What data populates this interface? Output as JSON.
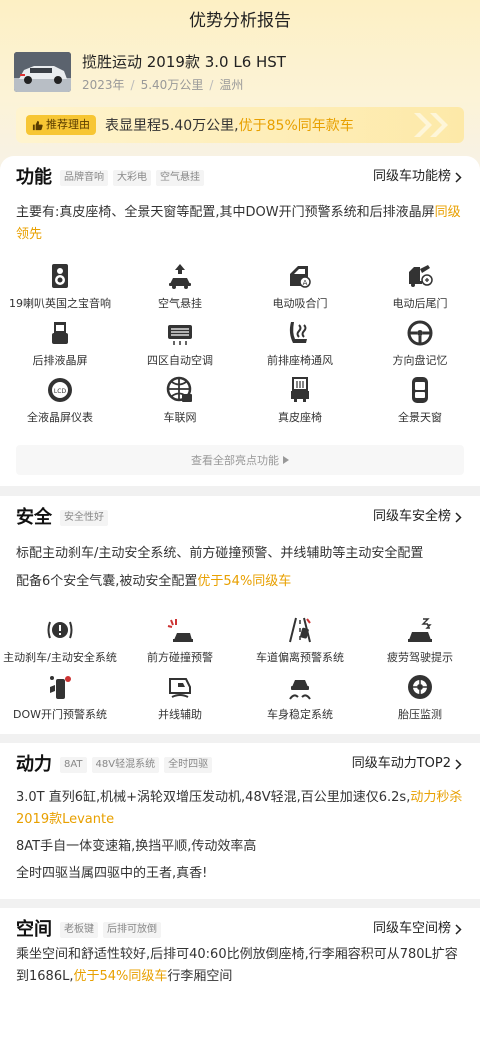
{
  "page_title": "优势分析报告",
  "car": {
    "title": "揽胜运动 2019款 3.0 L6 HST",
    "year": "2023年",
    "mileage": "5.40万公里",
    "city": "温州",
    "sep": "/"
  },
  "reason": {
    "badge": "推荐理由",
    "text_plain": "表显里程5.40万公里,",
    "text_highlight": "优于85%同年款车"
  },
  "function": {
    "title": "功能",
    "tags": [
      "品牌音响",
      "大彩电",
      "空气悬挂"
    ],
    "rank": "同级车功能榜",
    "desc_plain": "主要有:真皮座椅、全景天窗等配置,其中DOW开门预警系统和后排液晶屏",
    "desc_highlight": "同级领先",
    "features": [
      {
        "label": "19喇叭英国之宝音响",
        "icon": "speaker-icon"
      },
      {
        "label": "空气悬挂",
        "icon": "air-suspension-icon"
      },
      {
        "label": "电动吸合门",
        "icon": "soft-close-door-icon"
      },
      {
        "label": "电动后尾门",
        "icon": "power-tailgate-icon"
      },
      {
        "label": "后排液晶屏",
        "icon": "rear-screen-icon"
      },
      {
        "label": "四区自动空调",
        "icon": "climate-control-icon"
      },
      {
        "label": "前排座椅通风",
        "icon": "seat-ventilation-icon"
      },
      {
        "label": "方向盘记忆",
        "icon": "steering-memory-icon"
      },
      {
        "label": "全液晶屏仪表",
        "icon": "lcd-dashboard-icon"
      },
      {
        "label": "车联网",
        "icon": "connected-car-icon"
      },
      {
        "label": "真皮座椅",
        "icon": "leather-seat-icon"
      },
      {
        "label": "全景天窗",
        "icon": "panoramic-sunroof-icon"
      }
    ],
    "more": "查看全部亮点功能"
  },
  "safety": {
    "title": "安全",
    "tags": [
      "安全性好"
    ],
    "rank": "同级车安全榜",
    "desc_line1": "标配主动刹车/主动安全系统、前方碰撞预警、并线辅助等主动安全配置",
    "desc_line2_plain": "配备6个安全气囊,被动安全配置",
    "desc_line2_highlight": "优于54%同级车",
    "features": [
      {
        "label": "主动刹车/主动安全系统",
        "icon": "auto-brake-icon"
      },
      {
        "label": "前方碰撞预警",
        "icon": "collision-warning-icon"
      },
      {
        "label": "车道偏离预警系统",
        "icon": "lane-departure-icon"
      },
      {
        "label": "疲劳驾驶提示",
        "icon": "fatigue-alert-icon"
      },
      {
        "label": "DOW开门预警系统",
        "icon": "door-open-warning-icon"
      },
      {
        "label": "并线辅助",
        "icon": "blind-spot-icon"
      },
      {
        "label": "车身稳定系统",
        "icon": "stability-control-icon"
      },
      {
        "label": "胎压监测",
        "icon": "tire-pressure-icon"
      }
    ]
  },
  "power": {
    "title": "动力",
    "tags": [
      "8AT",
      "48V轻混系统",
      "全时四驱"
    ],
    "rank": "同级车动力TOP2",
    "desc1_plain": "3.0T 直列6缸,机械+涡轮双增压发动机,48V轻混,百公里加速仅6.2s,",
    "desc1_highlight": "动力秒杀 2019款Levante",
    "desc2": "8AT手自一体变速箱,换挡平顺,传动效率高",
    "desc3": "全时四驱当属四驱中的王者,真香!"
  },
  "space": {
    "title": "空间",
    "tags": [
      "老板键",
      "后排可放倒"
    ],
    "rank": "同级车空间榜",
    "desc_plain": "乘坐空间和舒适性较好,后排可40:60比例放倒座椅,行李厢容积可从780L扩容到1686L,",
    "desc_highlight": "优于54%同级车",
    "desc_tail": "行李厢空间"
  },
  "colors": {
    "accent": "#e8a000",
    "badge": "#f7c634"
  }
}
